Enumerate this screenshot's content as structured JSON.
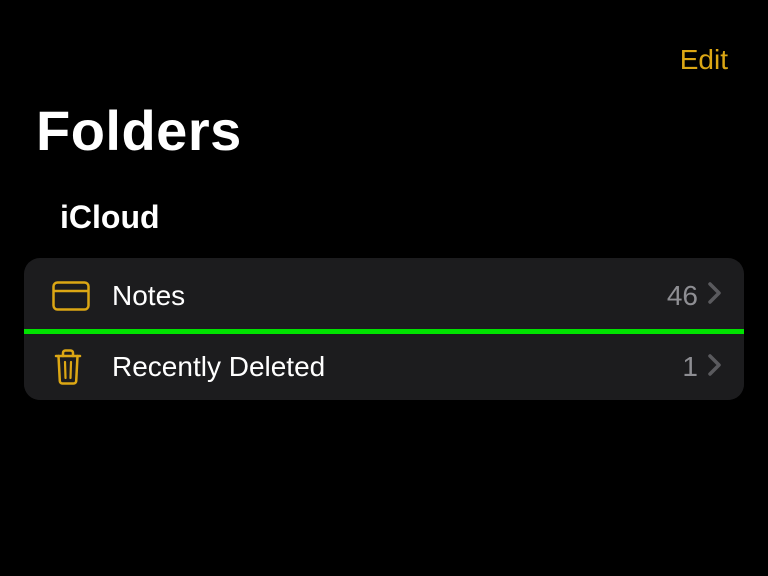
{
  "header": {
    "edit_label": "Edit"
  },
  "title": "Folders",
  "section": {
    "name": "iCloud",
    "folders": [
      {
        "icon": "folder",
        "label": "Notes",
        "count": "46",
        "highlighted": false
      },
      {
        "icon": "trash",
        "label": "Recently Deleted",
        "count": "1",
        "highlighted": true
      }
    ]
  },
  "colors": {
    "accent": "#dca714",
    "highlight_border": "#00e200"
  }
}
